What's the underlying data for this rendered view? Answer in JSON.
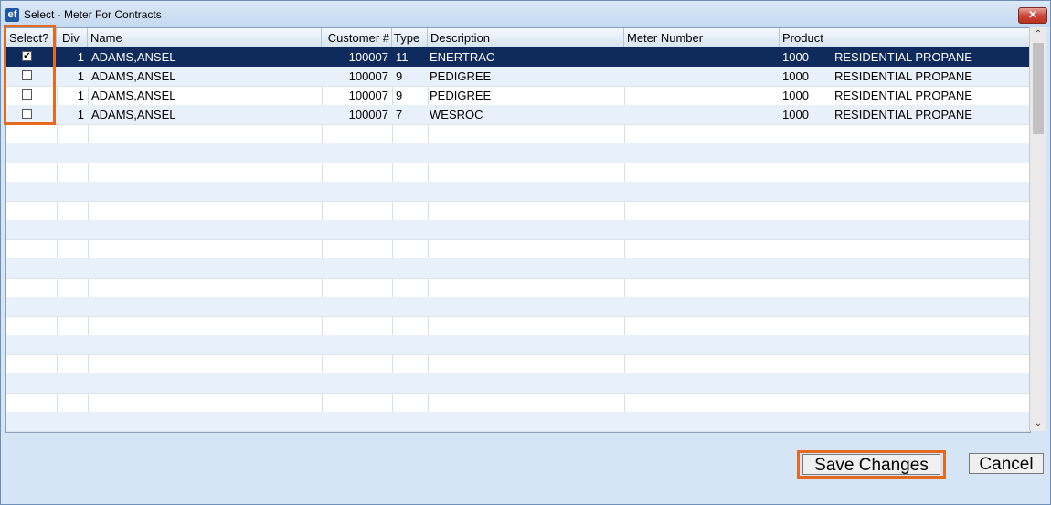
{
  "window": {
    "title": "Select - Meter For Contracts",
    "app_icon": "ef",
    "close_label": "✕"
  },
  "grid": {
    "columns": [
      "Select?",
      "Div",
      "Name",
      "Customer #",
      "Type",
      "Description",
      "Meter Number",
      "Product"
    ],
    "rows": [
      {
        "selected": true,
        "div": "1",
        "name": "ADAMS,ANSEL",
        "customer": "100007",
        "type": "11",
        "description": "ENERTRAC",
        "meter": "",
        "product_code": "1000",
        "product_name": "RESIDENTIAL PROPANE"
      },
      {
        "selected": false,
        "div": "1",
        "name": "ADAMS,ANSEL",
        "customer": "100007",
        "type": "9",
        "description": "PEDIGREE",
        "meter": "",
        "product_code": "1000",
        "product_name": "RESIDENTIAL PROPANE"
      },
      {
        "selected": false,
        "div": "1",
        "name": "ADAMS,ANSEL",
        "customer": "100007",
        "type": "9",
        "description": "PEDIGREE",
        "meter": "",
        "product_code": "1000",
        "product_name": "RESIDENTIAL PROPANE"
      },
      {
        "selected": false,
        "div": "1",
        "name": "ADAMS,ANSEL",
        "customer": "100007",
        "type": "7",
        "description": "WESROC",
        "meter": "",
        "product_code": "1000",
        "product_name": "RESIDENTIAL PROPANE"
      }
    ],
    "checked_glyph": "✔",
    "selected_row_color": "#0f2a5c",
    "alt_row_color": "#e8f0fa"
  },
  "scrollbar": {
    "up_icon": "⌃",
    "down_icon": "⌄"
  },
  "buttons": {
    "save": "Save Changes",
    "cancel": "Cancel"
  },
  "highlight_color": "#e46a22"
}
